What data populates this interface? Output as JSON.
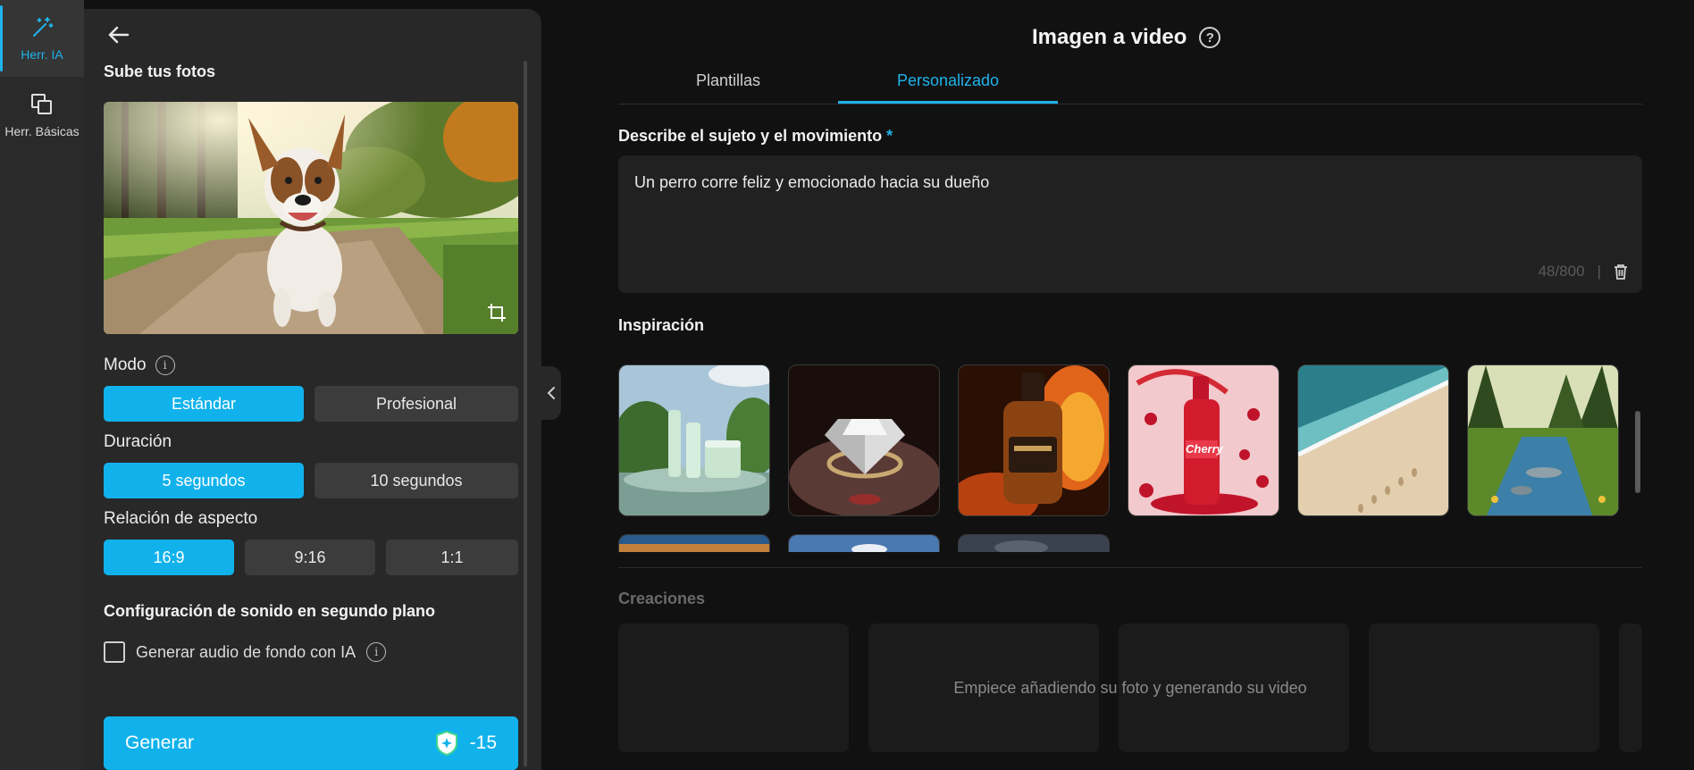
{
  "rail": {
    "items": [
      {
        "label": "Herr. IA",
        "icon": "magic-wand-icon",
        "active": true
      },
      {
        "label": "Herr. Básicas",
        "icon": "layers-icon",
        "active": false
      }
    ]
  },
  "panel": {
    "upload_title": "Sube tus fotos",
    "mode": {
      "label": "Modo",
      "options": [
        "Estándar",
        "Profesional"
      ],
      "selected": "Estándar"
    },
    "duration": {
      "label": "Duración",
      "options": [
        "5 segundos",
        "10 segundos"
      ],
      "selected": "5 segundos"
    },
    "aspect": {
      "label": "Relación de aspecto",
      "options": [
        "16:9",
        "9:16",
        "1:1"
      ],
      "selected": "16:9"
    },
    "sound": {
      "title": "Configuración de sonido en segundo plano",
      "checkbox_label": "Generar audio de fondo con IA",
      "checked": false
    },
    "generate": {
      "label": "Generar",
      "cost": "-15"
    }
  },
  "main": {
    "title": "Imagen a video",
    "tabs": [
      {
        "label": "Plantillas",
        "active": false
      },
      {
        "label": "Personalizado",
        "active": true
      }
    ],
    "prompt": {
      "label": "Describe el sujeto y el movimiento",
      "required_mark": "*",
      "value": "Un perro corre feliz y emocionado hacia su dueño",
      "counter": "48/800",
      "separator": "|"
    },
    "inspiration": {
      "label": "Inspiración",
      "items": [
        {
          "name": "inspiration-cosmetics"
        },
        {
          "name": "inspiration-diamond-ring"
        },
        {
          "name": "inspiration-whiskey-fire"
        },
        {
          "name": "inspiration-cherry-soda",
          "text": "Cherry"
        },
        {
          "name": "inspiration-beach"
        },
        {
          "name": "inspiration-forest-river"
        }
      ]
    },
    "creations": {
      "label": "Creaciones",
      "empty_message": "Empiece añadiendo su foto y generando su video"
    }
  },
  "colors": {
    "accent": "#11b2ec",
    "background": "#111111",
    "panel": "#282828"
  }
}
